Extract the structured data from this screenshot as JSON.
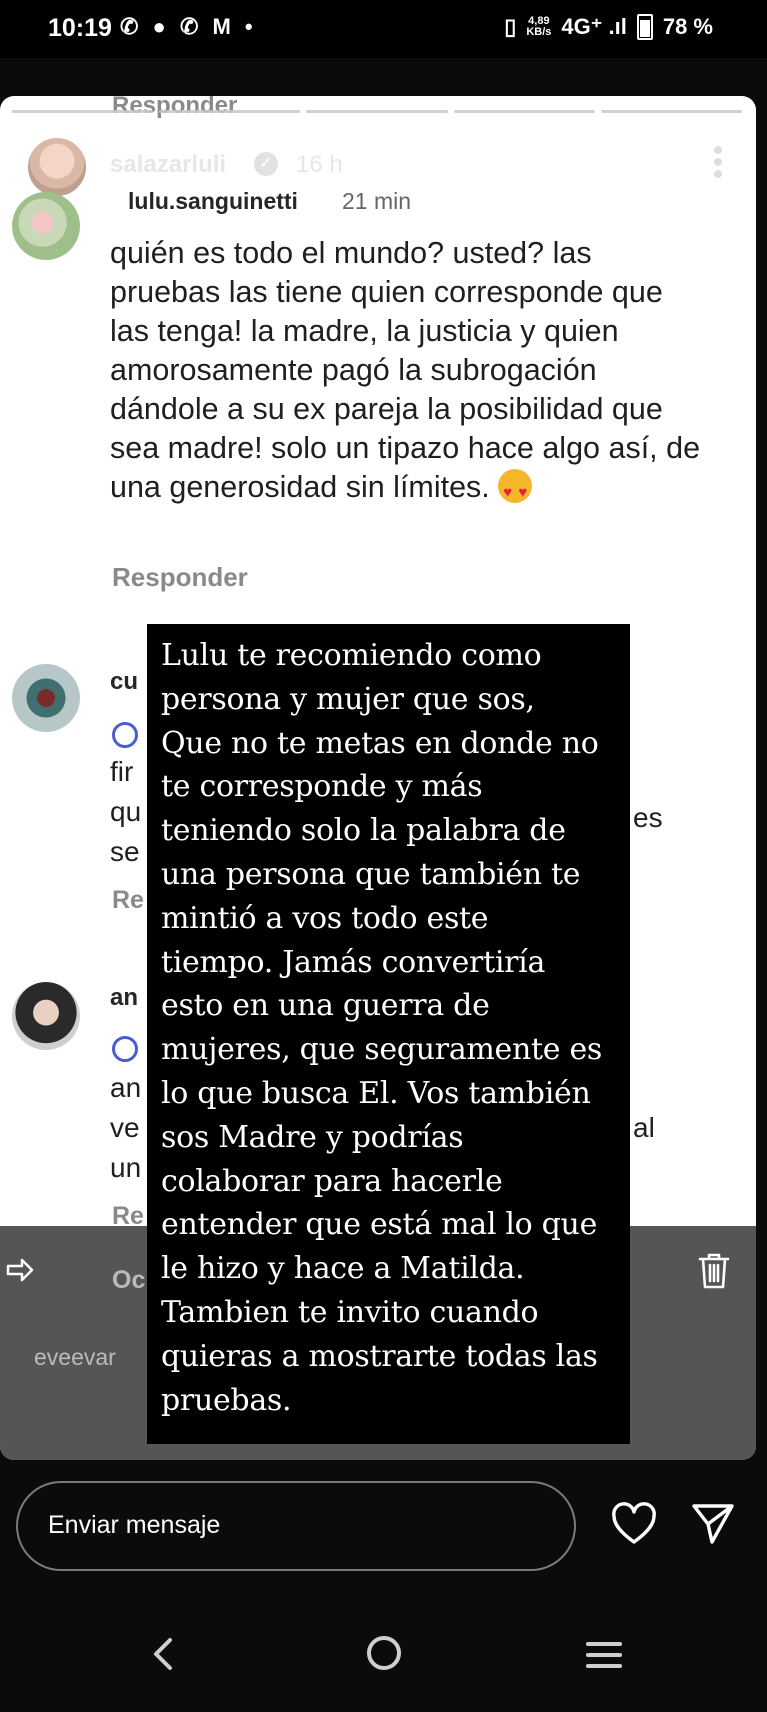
{
  "status_bar": {
    "time": "10:19",
    "notification_icons": "✆ ● ✆ M •",
    "speed_value": "4,89",
    "speed_unit": "KB/s",
    "network": "4G⁺ .ıl",
    "battery": "78 %"
  },
  "story": {
    "top_reply_label": "Responder",
    "owner": {
      "username": "salazarluli",
      "verified": true,
      "time": "16 h"
    },
    "comment": {
      "username": "lulu.sanguinetti",
      "time": "21 min",
      "text": "quién es todo el mundo? usted? las pruebas las tiene quien corresponde que las tenga! la madre, la justicia y quien amorosamente pagó la subrogación dándole a su ex pareja la posibilidad que sea madre! solo un tipazo hace algo así, de una generosidad sin límites.",
      "emoji": "smiling-face-with-heart-eyes",
      "reply_label": "Responder"
    },
    "hidden_fragments": {
      "cu": "cu",
      "fir": "fir",
      "qu": "qu",
      "se": "se",
      "re1": "Re",
      "es": "es",
      "an": "an",
      "an2": "an",
      "ve": "ve",
      "un": "un",
      "re2": "Re",
      "al": "al",
      "oc": "Oc",
      "user": "eveevar"
    },
    "text_box": "Lulu te recomiendo como\npersona y mujer que sos,\nQue no te metas en donde no\nte corresponde y más\nteniendo solo la palabra de\nuna persona que también te\nmintió a vos todo este\ntiempo. Jamás convertiría\nesto en una guerra de\nmujeres, que seguramente es\nlo que busca El. Vos también\nsos Madre y podrías\ncolaborar para hacerle\nentender que está mal lo que\nle hizo y hace a Matilda.\nTambien te invito cuando\nquieras a mostrarte todas las\npruebas."
  },
  "bottom": {
    "message_placeholder": "Enviar mensaje"
  }
}
